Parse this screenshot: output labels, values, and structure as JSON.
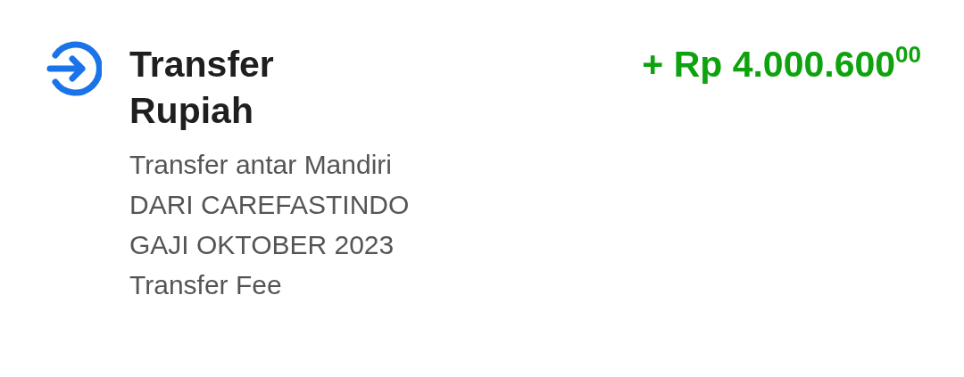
{
  "transaction": {
    "title_lines": [
      "Transfer",
      "Rupiah"
    ],
    "amount": "+ Rp 4.000.600$^{00}$",
    "details": [
      "Transfer antar Mandiri",
      "DARI CAREFASTINDO",
      "GAJI OKTOBER 2023",
      "Transfer Fee"
    ]
  }
}
